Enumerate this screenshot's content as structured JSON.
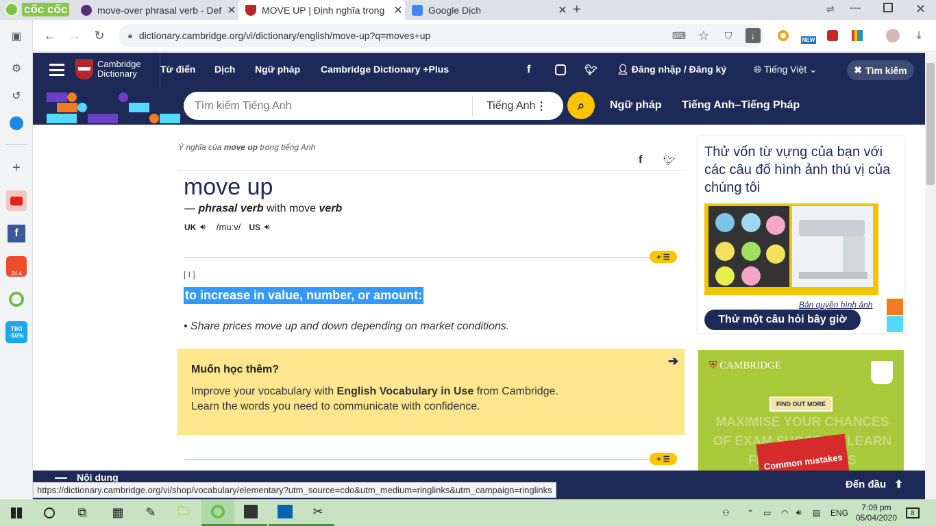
{
  "browser": {
    "brand": "cốc cốc",
    "tabs": [
      {
        "title": "move-over phrasal verb - Def",
        "active": false
      },
      {
        "title": "MOVE UP | Định nghĩa trong",
        "active": true
      },
      {
        "title": "Google Dịch",
        "active": false
      }
    ],
    "new_tab": "+",
    "url": "dictionary.cambridge.org/vi/dictionary/english/move-up?q=moves+up",
    "status_url": "https://dictionary.cambridge.org/vi/shop/vocabulary/elementary?utm_source=cdo&utm_medium=ringlinks&utm_campaign=ringlinks",
    "badge_new": "NEW",
    "tiki_label": "TIKI\n-50%",
    "shopee_label": "24.4"
  },
  "site": {
    "logo_line1": "Cambridge",
    "logo_line2": "Dictionary",
    "nav": [
      "Từ điển",
      "Dịch",
      "Ngữ pháp",
      "Cambridge Dictionary +Plus"
    ],
    "login": "Đăng nhập / Đăng ký",
    "language": "Tiếng Việt",
    "search_btn": "Tìm kiếm",
    "search_placeholder": "Tìm kiếm Tiếng Anh",
    "search_lang": "Tiếng Anh",
    "sub_links": [
      "Ngữ pháp",
      "Tiếng Anh–Tiếng Pháp"
    ]
  },
  "entry": {
    "meaning_prefix": "Ý nghĩa của ",
    "word_bold": "move up",
    "meaning_suffix": " trong tiếng Anh",
    "headword": "move up",
    "dash": "— ",
    "pos": "phrasal verb",
    "with": " with move ",
    "pos2": "verb",
    "uk": "UK",
    "us": "US",
    "ipa": "/muːv/",
    "grammar": "[ I ]",
    "definition": "to increase in value, number, or amount:",
    "example": "Share prices move up and down depending on market conditions.",
    "plus_label": "+ ☰"
  },
  "learn_more": {
    "title": "Muốn học thêm?",
    "line1_pre": "Improve your vocabulary with ",
    "line1_bold": "English Vocabulary in Use",
    "line1_post": " from Cambridge.",
    "line2": "Learn the words you need to communicate with confidence."
  },
  "quiz": {
    "text": "Thử vốn từ vựng của bạn với các câu đố hình ảnh thú vị của chúng tôi",
    "copyright": "Bản quyền hình ảnh",
    "button": "Thử một câu hỏi bây giờ"
  },
  "ad": {
    "brand": "CAMBRIDGE",
    "cta": "FIND OUT MORE",
    "faded": "MAXIMISE YOUR CHANCES OF EXAM SUCCESS! LEARN FROM MISTAKES",
    "book": "Common mistakes"
  },
  "footer": {
    "left": "Nội dung",
    "back_to_top": "Đến đầu"
  },
  "taskbar": {
    "lang": "ENG",
    "time": "7:09 pm",
    "date": "05/04/2020",
    "notif": "8"
  },
  "colors": {
    "navy": "#1d2a57",
    "yellow": "#fec400",
    "highlight": "#3399ff"
  }
}
